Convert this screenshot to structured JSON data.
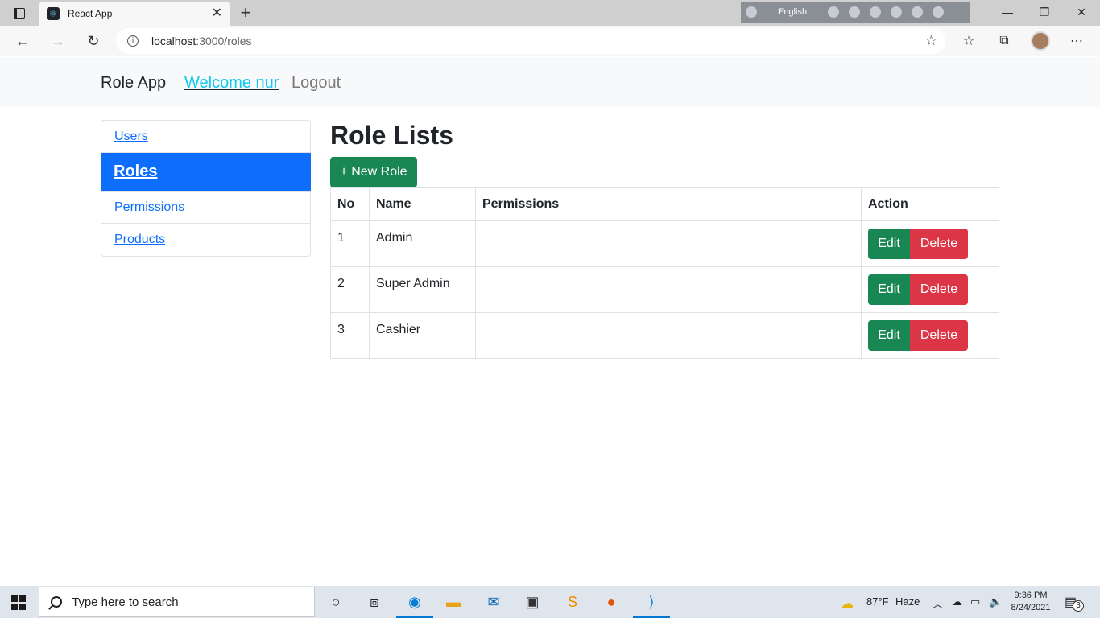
{
  "browser": {
    "tab_title": "React App",
    "url_host": "localhost",
    "url_path": ":3000/roles",
    "language": "English"
  },
  "navbar": {
    "brand": "Role App",
    "welcome": "Welcome nur",
    "logout": "Logout"
  },
  "sidebar": {
    "items": [
      {
        "label": "Users",
        "active": false
      },
      {
        "label": "Roles",
        "active": true
      },
      {
        "label": "Permissions",
        "active": false
      },
      {
        "label": "Products",
        "active": false
      }
    ]
  },
  "main": {
    "title": "Role Lists",
    "new_button": "+ New Role",
    "table": {
      "headers": [
        "No",
        "Name",
        "Permissions",
        "Action"
      ],
      "rows": [
        {
          "no": "1",
          "name": "Admin",
          "permissions": "",
          "edit": "Edit",
          "delete": "Delete"
        },
        {
          "no": "2",
          "name": "Super Admin",
          "permissions": "",
          "edit": "Edit",
          "delete": "Delete"
        },
        {
          "no": "3",
          "name": "Cashier",
          "permissions": "",
          "edit": "Edit",
          "delete": "Delete"
        }
      ]
    }
  },
  "taskbar": {
    "search_placeholder": "Type here to search",
    "weather_temp": "87°F",
    "weather_desc": "Haze",
    "time": "9:36 PM",
    "date": "8/24/2021",
    "notification_count": "3"
  },
  "colors": {
    "primary": "#0d6efd",
    "success": "#198754",
    "danger": "#dc3545",
    "info": "#0dcaf0"
  }
}
